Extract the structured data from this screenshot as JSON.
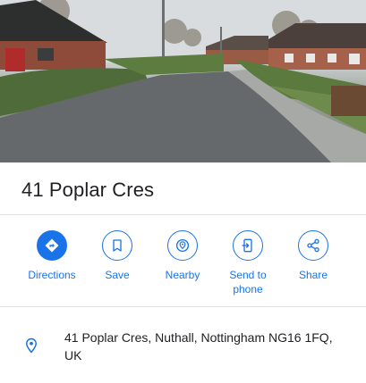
{
  "place": {
    "title": "41 Poplar Cres",
    "address": "41 Poplar Cres, Nuthall, Nottingham NG16 1FQ, UK"
  },
  "actions": [
    {
      "label": "Directions",
      "icon": "directions-icon"
    },
    {
      "label": "Save",
      "icon": "bookmark-icon"
    },
    {
      "label": "Nearby",
      "icon": "nearby-icon"
    },
    {
      "label": "Send to phone",
      "icon": "send-to-phone-icon"
    },
    {
      "label": "Share",
      "icon": "share-icon"
    }
  ],
  "colors": {
    "accent": "#1a73e8",
    "divider": "#e0e0e0",
    "text": "#202124"
  }
}
